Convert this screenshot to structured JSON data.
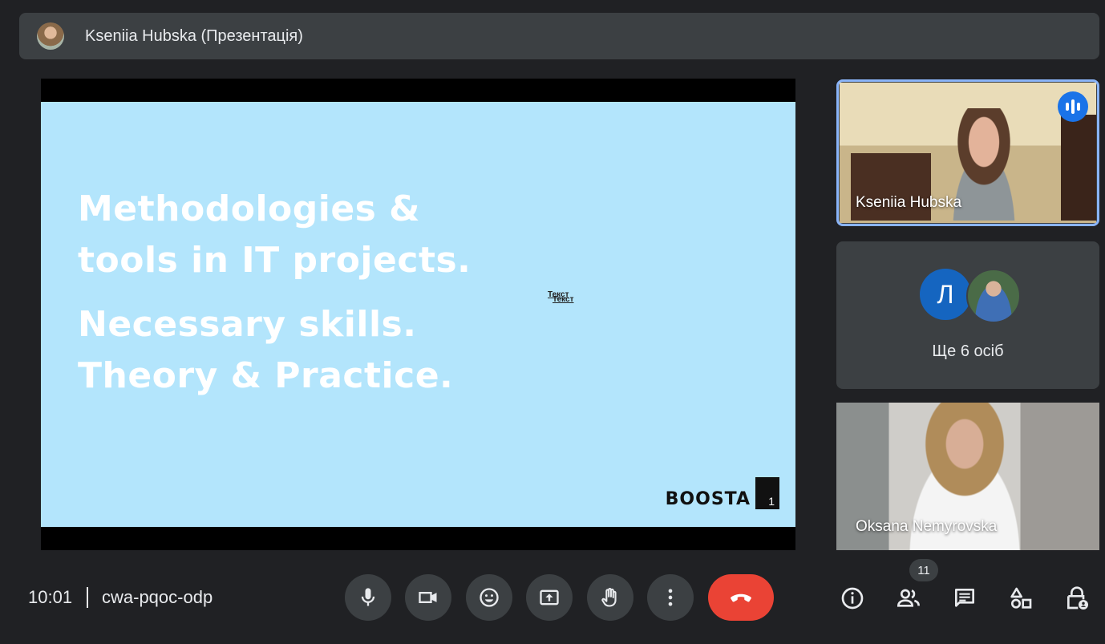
{
  "header": {
    "presenter_title": "Kseniia Hubska (Презентація)"
  },
  "slide": {
    "lines": [
      "Methodologies &",
      "tools in IT projects.",
      "Necessary skills.",
      "Theory & Practice."
    ],
    "placeholder_1": "Текст",
    "placeholder_2": "Текст",
    "brand_word": "BOOSTA",
    "page_number": "1"
  },
  "participants": {
    "tile1_name": "Kseniia Hubska",
    "group_initial": "Л",
    "group_more": "Ще 6 осіб",
    "tile3_name": "Oksana Nemyrovska"
  },
  "meeting": {
    "time": "10:01",
    "code": "cwa-pqoc-odp",
    "participant_count": "11"
  },
  "colors": {
    "background": "#202124",
    "panel": "#3c4043",
    "slide_bg": "#b3e5fc",
    "end_call": "#ea4335",
    "accent": "#8ab4f8",
    "speaking": "#1a73e8"
  }
}
